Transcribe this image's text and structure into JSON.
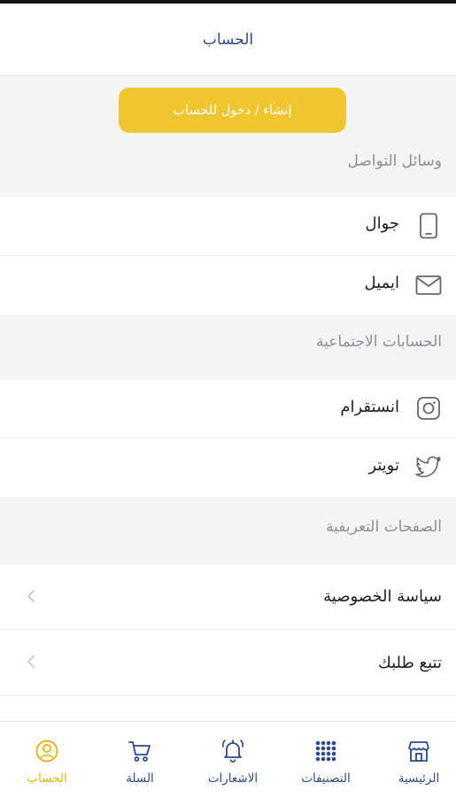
{
  "header": {
    "title": "الحساب"
  },
  "login_button": {
    "label": "إنشاء / دخول للحساب"
  },
  "sections": {
    "contact": {
      "title": "وسائل التواصل",
      "items": [
        {
          "label": "جوال",
          "icon": "mobile-phone-icon"
        },
        {
          "label": "ايميل",
          "icon": "envelope-icon"
        }
      ]
    },
    "social": {
      "title": "الحسابات الاجتماعية",
      "items": [
        {
          "label": "انستقرام",
          "icon": "instagram-icon"
        },
        {
          "label": "تويتر",
          "icon": "twitter-icon"
        }
      ]
    },
    "pages": {
      "title": "الصفحات التعريفية",
      "items": [
        {
          "label": "سياسة الخصوصية",
          "icon": "chevron-left-icon"
        },
        {
          "label": "تتبع طلبك",
          "icon": "chevron-left-icon"
        }
      ]
    }
  },
  "bottom_nav": {
    "items": [
      {
        "label": "الرئيسية",
        "icon": "store-icon"
      },
      {
        "label": "التصنيفات",
        "icon": "grid-dots-icon"
      },
      {
        "label": "الاشعارات",
        "icon": "bell-icon"
      },
      {
        "label": "السلة",
        "icon": "cart-icon"
      },
      {
        "label": "الحساب",
        "icon": "user-circle-icon",
        "active": true
      }
    ]
  },
  "colors": {
    "accent": "#f0c630",
    "primary": "#2e4a87",
    "active": "#e2b514",
    "muted": "#8f8f94"
  }
}
